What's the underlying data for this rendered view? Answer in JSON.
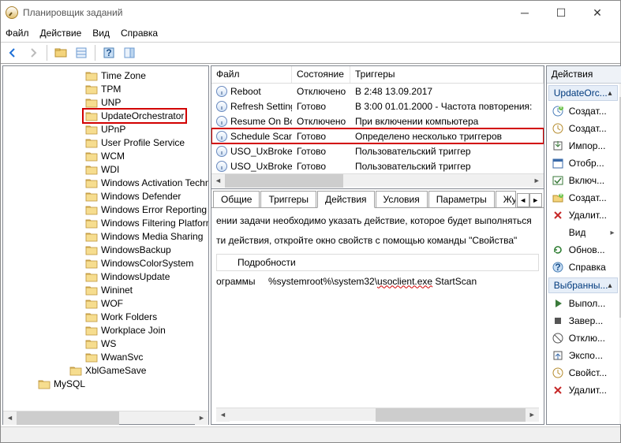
{
  "window": {
    "title": "Планировщик заданий"
  },
  "menu": {
    "file": "Файл",
    "action": "Действие",
    "view": "Вид",
    "help": "Справка"
  },
  "tree": {
    "items": [
      {
        "label": "Time Zone",
        "indent": 104
      },
      {
        "label": "TPM",
        "indent": 104
      },
      {
        "label": "UNP",
        "indent": 104
      },
      {
        "label": "UpdateOrchestrator",
        "indent": 104,
        "highlight": true
      },
      {
        "label": "UPnP",
        "indent": 104
      },
      {
        "label": "User Profile Service",
        "indent": 104
      },
      {
        "label": "WCM",
        "indent": 104
      },
      {
        "label": "WDI",
        "indent": 104
      },
      {
        "label": "Windows Activation Technologies",
        "indent": 104
      },
      {
        "label": "Windows Defender",
        "indent": 104
      },
      {
        "label": "Windows Error Reporting",
        "indent": 104
      },
      {
        "label": "Windows Filtering Platform",
        "indent": 104
      },
      {
        "label": "Windows Media Sharing",
        "indent": 104
      },
      {
        "label": "WindowsBackup",
        "indent": 104
      },
      {
        "label": "WindowsColorSystem",
        "indent": 104
      },
      {
        "label": "WindowsUpdate",
        "indent": 104
      },
      {
        "label": "Wininet",
        "indent": 104
      },
      {
        "label": "WOF",
        "indent": 104
      },
      {
        "label": "Work Folders",
        "indent": 104
      },
      {
        "label": "Workplace Join",
        "indent": 104
      },
      {
        "label": "WS",
        "indent": 104
      },
      {
        "label": "WwanSvc",
        "indent": 104
      },
      {
        "label": "XblGameSave",
        "indent": 84
      },
      {
        "label": "MySQL",
        "indent": 44
      }
    ]
  },
  "tasklist": {
    "headers": {
      "file": "Файл",
      "state": "Состояние",
      "triggers": "Триггеры"
    },
    "rows": [
      {
        "name": "Reboot",
        "state": "Отключено",
        "trigger": "В 2:48 13.09.2017"
      },
      {
        "name": "Refresh Settings",
        "state": "Готово",
        "trigger": "В 3:00 01.01.2000 - Частота повторения:"
      },
      {
        "name": "Resume On Boot",
        "state": "Отключено",
        "trigger": "При включении компьютера"
      },
      {
        "name": "Schedule Scan",
        "state": "Готово",
        "trigger": "Определено несколько триггеров",
        "highlight": true
      },
      {
        "name": "USO_UxBroker",
        "state": "Готово",
        "trigger": "Пользовательский триггер"
      },
      {
        "name": "USO_UxBroker",
        "state": "Готово",
        "trigger": "Пользовательский триггер"
      }
    ]
  },
  "tabs": {
    "general": "Общие",
    "triggers": "Триггеры",
    "actions": "Действия",
    "conditions": "Условия",
    "params": "Параметры",
    "log": "Журнал"
  },
  "detail": {
    "desc1": "ении задачи необходимо указать действие, которое будет выполняться",
    "desc2": "ти действия, откройте окно свойств с помощью команды \"Свойства\"",
    "colhead": "Подробности",
    "col1": "ограммы",
    "col2_pre": "%systemroot%\\system32\\",
    "col2_und": "usoclient.exe",
    "col2_post": " StartScan"
  },
  "actions": {
    "title": "Действия",
    "group1": "UpdateOrc...",
    "items1": [
      {
        "icon": "clock-new",
        "label": "Создат..."
      },
      {
        "icon": "clock",
        "label": "Создат..."
      },
      {
        "icon": "import",
        "label": "Импор..."
      },
      {
        "icon": "calendar",
        "label": "Отобр..."
      },
      {
        "icon": "enable",
        "label": "Включ..."
      },
      {
        "icon": "folder-new",
        "label": "Создат..."
      },
      {
        "icon": "delete",
        "label": "Удалит..."
      },
      {
        "icon": "view",
        "label": "Вид",
        "sub": "▸"
      },
      {
        "icon": "refresh",
        "label": "Обнов..."
      },
      {
        "icon": "help",
        "label": "Справка"
      }
    ],
    "group2": "Выбранны...",
    "items2": [
      {
        "icon": "run",
        "label": "Выпол..."
      },
      {
        "icon": "stop",
        "label": "Завер..."
      },
      {
        "icon": "disable",
        "label": "Отклю..."
      },
      {
        "icon": "export",
        "label": "Экспо..."
      },
      {
        "icon": "clock",
        "label": "Свойст..."
      },
      {
        "icon": "delete",
        "label": "Удалит..."
      }
    ]
  }
}
